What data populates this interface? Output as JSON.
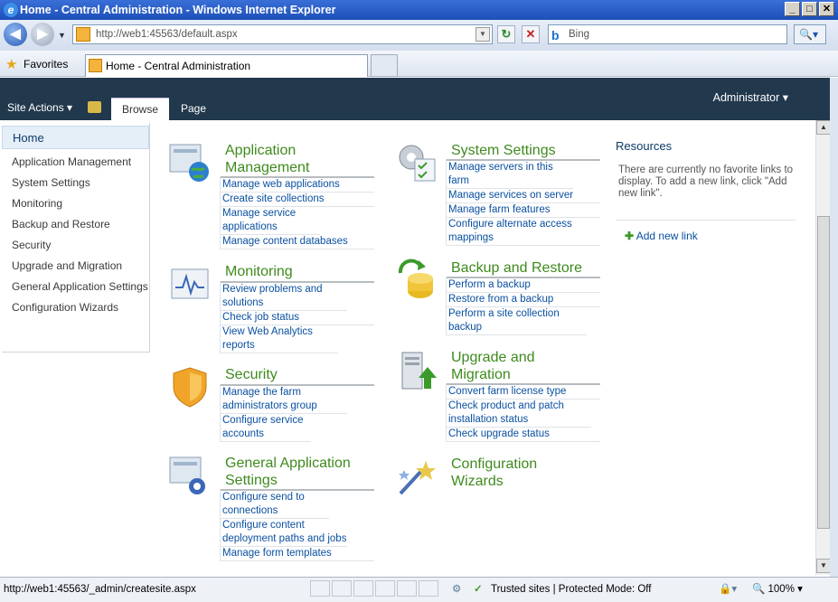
{
  "window": {
    "title": "Home - Central Administration - Windows Internet Explorer"
  },
  "browser": {
    "url": "http://web1:45563/default.aspx",
    "search_placeholder": "Bing",
    "favorites_label": "Favorites",
    "tab_title": "Home - Central Administration"
  },
  "ribbon": {
    "site_actions": "Site Actions ▾",
    "tabs": [
      "Browse",
      "Page"
    ],
    "user": "Administrator ▾"
  },
  "left_nav": {
    "items": [
      "Home",
      "Application Management",
      "System Settings",
      "Monitoring",
      "Backup and Restore",
      "Security",
      "Upgrade and Migration",
      "General Application Settings",
      "Configuration Wizards"
    ]
  },
  "sections": {
    "app_mgmt": {
      "title": "Application\nManagement",
      "links": [
        "Manage web applications",
        "Create site collections",
        "Manage service applications",
        "Manage content databases"
      ]
    },
    "monitoring": {
      "title": "Monitoring",
      "links": [
        "Review problems and solutions",
        "Check job status",
        "View Web Analytics reports"
      ]
    },
    "security": {
      "title": "Security",
      "links": [
        "Manage the farm administrators group",
        "Configure service accounts"
      ]
    },
    "general": {
      "title": "General Application\nSettings",
      "links": [
        "Configure send to connections",
        "Configure content deployment paths and jobs",
        "Manage form templates"
      ]
    },
    "system": {
      "title": "System Settings",
      "links": [
        "Manage servers in this farm",
        "Manage services on server",
        "Manage farm features",
        "Configure alternate access mappings"
      ]
    },
    "backup": {
      "title": "Backup and Restore",
      "links": [
        "Perform a backup",
        "Restore from a backup",
        "Perform a site collection backup"
      ]
    },
    "upgrade": {
      "title": "Upgrade and\nMigration",
      "links": [
        "Convert farm license type",
        "Check product and patch installation status",
        "Check upgrade status"
      ]
    },
    "wizards": {
      "title": "Configuration\nWizards"
    }
  },
  "resources": {
    "heading": "Resources",
    "body": "There are currently no favorite links to display. To add a new link, click \"Add new link\".",
    "add_link": "Add new link"
  },
  "status": {
    "url": "http://web1:45563/_admin/createsite.aspx",
    "zone": "Trusted sites | Protected Mode: Off",
    "zoom": "100%"
  },
  "colors": {
    "ribbon_bg": "#21384d",
    "section_title": "#3f8a1e",
    "link": "#0a50a0"
  }
}
